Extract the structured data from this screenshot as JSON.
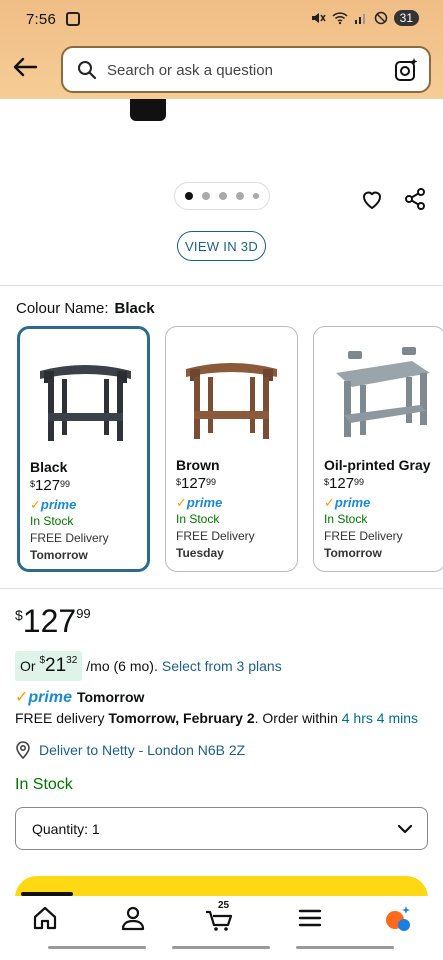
{
  "status_bar": {
    "time": "7:56",
    "battery": "31"
  },
  "search": {
    "placeholder": "Search or ask a question"
  },
  "gallery": {
    "view3d_label": "VIEW IN 3D",
    "dot_count": 5,
    "active_dot": 0
  },
  "colour": {
    "label": "Colour Name:",
    "selected": "Black"
  },
  "variants": [
    {
      "name": "Black",
      "price_whole": "127",
      "price_frac": "99",
      "currency": "$",
      "prime": "prime",
      "stock": "In Stock",
      "delivery": "FREE Delivery",
      "when": "Tomorrow",
      "color": "#3c4148"
    },
    {
      "name": "Brown",
      "price_whole": "127",
      "price_frac": "99",
      "currency": "$",
      "prime": "prime",
      "stock": "In Stock",
      "delivery": "FREE Delivery",
      "when": "Tuesday",
      "color": "#8a5a3a"
    },
    {
      "name": "Oil-printed Gray",
      "price_whole": "127",
      "price_frac": "99",
      "currency": "$",
      "prime": "prime",
      "stock": "In Stock",
      "delivery": "FREE Delivery",
      "when": "Tomorrow",
      "color": "#8e999f"
    }
  ],
  "price": {
    "currency": "$",
    "whole": "127",
    "frac": "99"
  },
  "monthly": {
    "prefix": "Or ",
    "currency": "$",
    "whole": "21",
    "frac": "32",
    "suffix": "/mo (6 mo).",
    "link": "Select from 3 plans"
  },
  "prime_delivery": {
    "prime": "prime",
    "when": "Tomorrow"
  },
  "free_delivery": {
    "prefix": "FREE delivery ",
    "date": "Tomorrow, February 2",
    "mid": ". Order within ",
    "countdown": "4 hrs 4 mins"
  },
  "location": {
    "text": "Deliver to Netty - London N6B 2Z"
  },
  "stock_status": "In Stock",
  "quantity": {
    "label": "Quantity:",
    "value": "1"
  },
  "bottom_nav": {
    "cart_count": "25"
  },
  "colors": {
    "accent": "#1f5f80",
    "stock_green": "#007600",
    "prime_blue": "#1a8ad0",
    "buy_yellow": "#ffd814",
    "header_bg": "#f4c58e"
  }
}
